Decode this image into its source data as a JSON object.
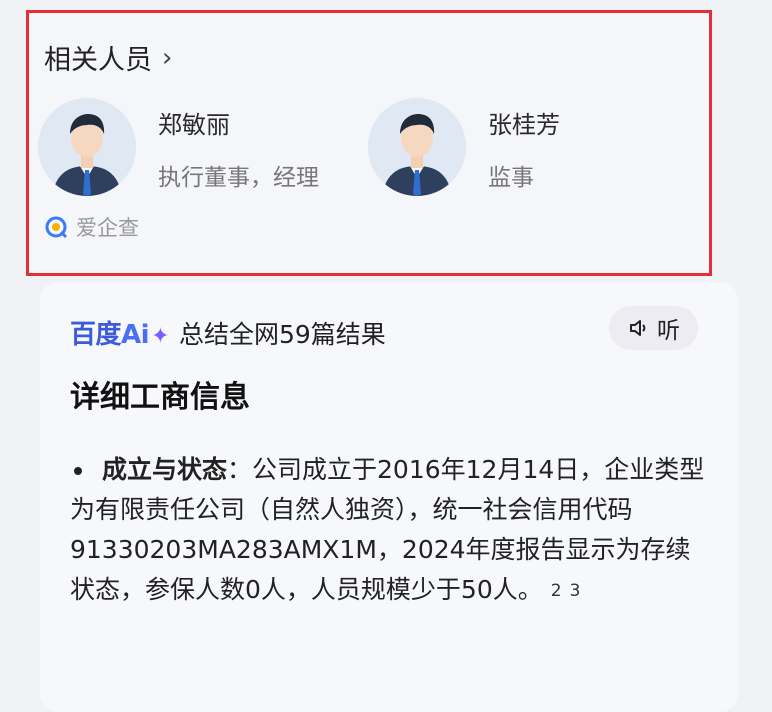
{
  "people_section": {
    "title": "相关人员",
    "people": [
      {
        "name": "郑敏丽",
        "role": "执行董事，经理"
      },
      {
        "name": "张桂芳",
        "role": "监事"
      }
    ],
    "source": "爱企查"
  },
  "ai_summary": {
    "brand_prefix": "百度",
    "brand_ai": "Ai",
    "summary_text": "总结全网59篇结果",
    "listen_label": "听",
    "detail_title": "详细工商信息",
    "item_label": "成立与状态",
    "item_colon": "：",
    "item_text": "公司成立于2016年12月14日，企业类型为有限责任公司（自然人独资），统一社会信用代码91330203MA283AMX1M，2024年度报告显示为存续状态，参保人数0人，人员规模少于50人。",
    "citations": [
      "2",
      "3"
    ]
  },
  "colors": {
    "highlight_border": "#e0313b",
    "brand": "#3b5bdb",
    "spark": "#7c5cff"
  }
}
